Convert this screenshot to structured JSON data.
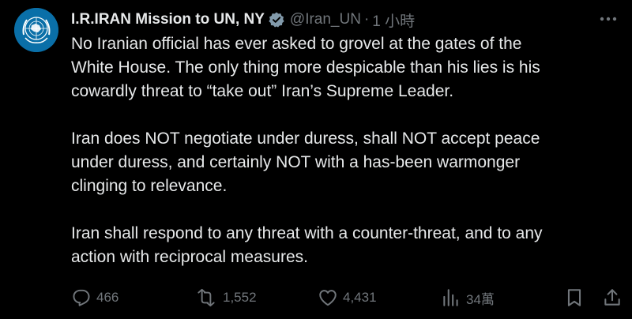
{
  "account": {
    "display_name": "I.R.IRAN Mission to UN, NY",
    "handle": "@Iran_UN",
    "separator": "·",
    "time": "1 小時"
  },
  "tweet": {
    "paragraphs": [
      {
        "lines": [
          "No Iranian official has ever asked to grovel at the gates of the",
          "White House. The only thing more despicable than his lies is his",
          "cowardly threat to “take out” Iran’s Supreme Leader."
        ]
      },
      {
        "lines": [
          "Iran does NOT negotiate under duress, shall NOT accept peace",
          "under duress, and certainly NOT with a has-been warmonger",
          "clinging to relevance."
        ]
      },
      {
        "lines": [
          "Iran shall respond to any threat with a counter-threat, and to any",
          "action with reciprocal measures."
        ]
      }
    ]
  },
  "actions": {
    "replies": "466",
    "reposts": "1,552",
    "likes": "4,431",
    "views": "34萬"
  },
  "icons": {
    "verified": "verified-badge-icon",
    "more": "more-icon",
    "reply": "reply-icon",
    "repost": "repost-icon",
    "like": "like-icon",
    "views": "views-icon",
    "bookmark": "bookmark-icon",
    "share": "share-icon"
  },
  "colors": {
    "background": "#000000",
    "text": "#e7e9ea",
    "secondary": "#71767b",
    "avatar": "#0a6fa8",
    "verified_badge": "#829aab"
  }
}
